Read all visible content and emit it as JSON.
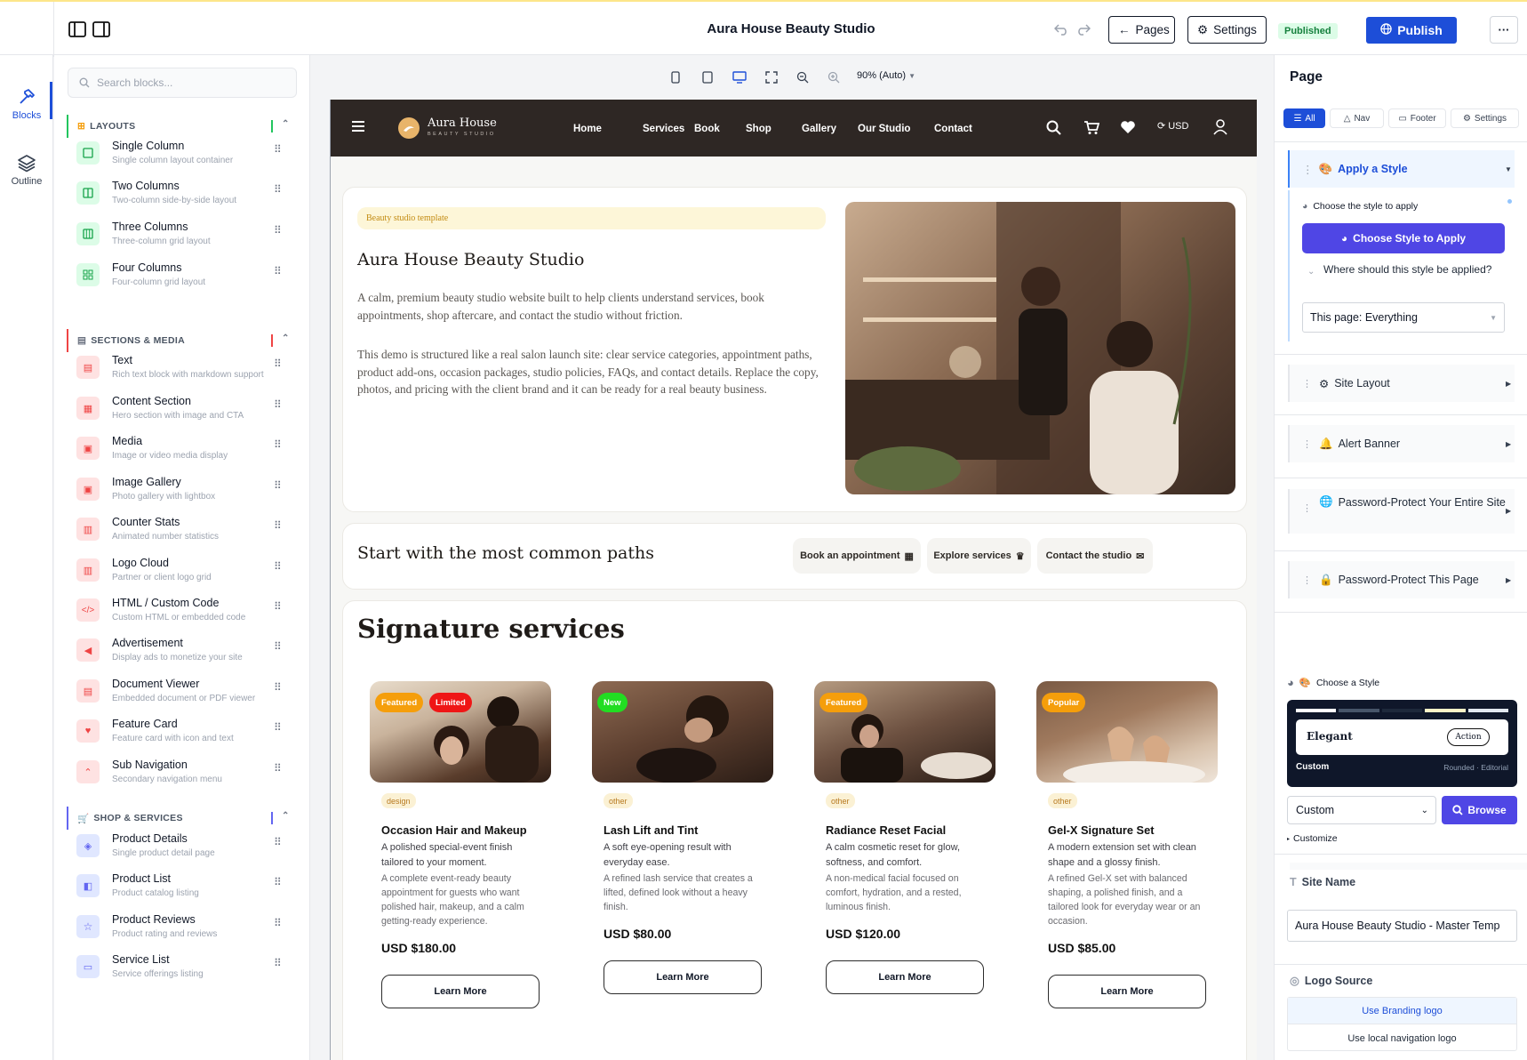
{
  "app": {
    "title": "Aura House Beauty Studio",
    "pages_label": "Pages",
    "settings_label": "Settings",
    "status_badge": "Published",
    "publish_label": "Publish",
    "more_label": "···"
  },
  "rail": {
    "blocks_label": "Blocks",
    "outline_label": "Outline"
  },
  "blocks_panel": {
    "search_placeholder": "Search blocks...",
    "categories": [
      {
        "label": "LAYOUTS",
        "items": [
          {
            "title": "Single Column",
            "subtitle": "Single column layout container"
          },
          {
            "title": "Two Columns",
            "subtitle": "Two-column side-by-side layout"
          },
          {
            "title": "Three Columns",
            "subtitle": "Three-column grid layout"
          },
          {
            "title": "Four Columns",
            "subtitle": "Four-column grid layout"
          }
        ]
      },
      {
        "label": "SECTIONS & MEDIA",
        "items": [
          {
            "title": "Text",
            "subtitle": "Rich text block with markdown support"
          },
          {
            "title": "Content Section",
            "subtitle": "Hero section with image and CTA"
          },
          {
            "title": "Media",
            "subtitle": "Image or video media display"
          },
          {
            "title": "Image Gallery",
            "subtitle": "Photo gallery with lightbox"
          },
          {
            "title": "Counter Stats",
            "subtitle": "Animated number statistics"
          },
          {
            "title": "Logo Cloud",
            "subtitle": "Partner or client logo grid"
          },
          {
            "title": "HTML / Custom Code",
            "subtitle": "Custom HTML or embedded code"
          },
          {
            "title": "Advertisement",
            "subtitle": "Display ads to monetize your site"
          },
          {
            "title": "Document Viewer",
            "subtitle": "Embedded document or PDF viewer"
          },
          {
            "title": "Feature Card",
            "subtitle": "Feature card with icon and text"
          },
          {
            "title": "Sub Navigation",
            "subtitle": "Secondary navigation menu"
          }
        ]
      },
      {
        "label": "SHOP & SERVICES",
        "items": [
          {
            "title": "Product Details",
            "subtitle": "Single product detail page"
          },
          {
            "title": "Product List",
            "subtitle": "Product catalog listing"
          },
          {
            "title": "Product Reviews",
            "subtitle": "Product rating and reviews"
          },
          {
            "title": "Service List",
            "subtitle": "Service offerings listing"
          }
        ]
      }
    ]
  },
  "canvas": {
    "zoom_label": "90% (Auto)"
  },
  "site": {
    "logo_name": "Aura House",
    "logo_tagline": "BEAUTY STUDIO",
    "nav": [
      "Home",
      "Services",
      "Book",
      "Shop",
      "Gallery",
      "Our Studio",
      "Contact"
    ],
    "currency": "USD",
    "hero": {
      "chip": "Beauty studio template",
      "title": "Aura House Beauty Studio",
      "p1": "A calm, premium beauty studio website built to help clients understand services, book appointments, shop aftercare, and contact the studio without friction.",
      "p2": "This demo is structured like a real salon launch site: clear service categories, appointment paths, product add-ons, occasion packages, studio policies, FAQs, and contact details. Replace the copy, photos, and pricing with the client brand and it can be ready for a real beauty business."
    },
    "paths": {
      "title": "Start with the most common paths",
      "buttons": [
        "Book an appointment",
        "Explore services",
        "Contact the studio"
      ]
    },
    "services": {
      "title": "Signature services",
      "learn_more": "Learn More",
      "cards": [
        {
          "badges": [
            "Featured",
            "Limited"
          ],
          "category": "design",
          "name": "Occasion Hair and Makeup",
          "desc": "A polished special-event finish tailored to your moment.",
          "desc2": "A complete event-ready beauty appointment for guests who want polished hair, makeup, and a calm getting-ready experience.",
          "price": "USD $180.00"
        },
        {
          "badges": [
            "New"
          ],
          "category": "other",
          "name": "Lash Lift and Tint",
          "desc": "A soft eye-opening result with everyday ease.",
          "desc2": "A refined lash service that creates a lifted, defined look without a heavy finish.",
          "price": "USD $80.00"
        },
        {
          "badges": [
            "Featured"
          ],
          "category": "other",
          "name": "Radiance Reset Facial",
          "desc": "A calm cosmetic reset for glow, softness, and comfort.",
          "desc2": "A non-medical facial focused on comfort, hydration, and a rested, luminous finish.",
          "price": "USD $120.00"
        },
        {
          "badges": [
            "Popular"
          ],
          "category": "other",
          "name": "Gel-X Signature Set",
          "desc": "A modern extension set with clean shape and a glossy finish.",
          "desc2": "A refined Gel-X set with balanced shaping, a polished finish, and a tailored look for everyday wear or an occasion.",
          "price": "USD $85.00"
        }
      ]
    }
  },
  "right_panel": {
    "title": "Page",
    "filters": [
      "All",
      "Nav",
      "Footer",
      "Settings"
    ],
    "apply_style": {
      "header": "Apply a Style",
      "choose_label": "Choose the style to apply",
      "choose_button": "Choose Style to Apply",
      "where_label": "Where should this style be applied?",
      "where_value": "This page: Everything"
    },
    "sections": [
      "Site Layout",
      "Alert Banner",
      "Password-Protect Your Entire Site",
      "Password-Protect This Page"
    ],
    "choose_style": {
      "label": "Choose a Style",
      "preview_name": "Elegant",
      "preview_action": "Action",
      "preview_label": "Custom",
      "preview_meta": "Rounded · Editorial",
      "select_value": "Custom",
      "browse_label": "Browse",
      "customize_label": "Customize"
    },
    "site_name": {
      "label": "Site Name",
      "value": "Aura House Beauty Studio - Master Temp"
    },
    "logo_source": {
      "label": "Logo Source",
      "options": [
        "Use Branding logo",
        "Use local navigation logo"
      ]
    }
  },
  "colors": {
    "accent": "#1d4ed8",
    "violet": "#4f46e5",
    "nav_bg": "#2e2724",
    "gold": "#c28a10"
  }
}
